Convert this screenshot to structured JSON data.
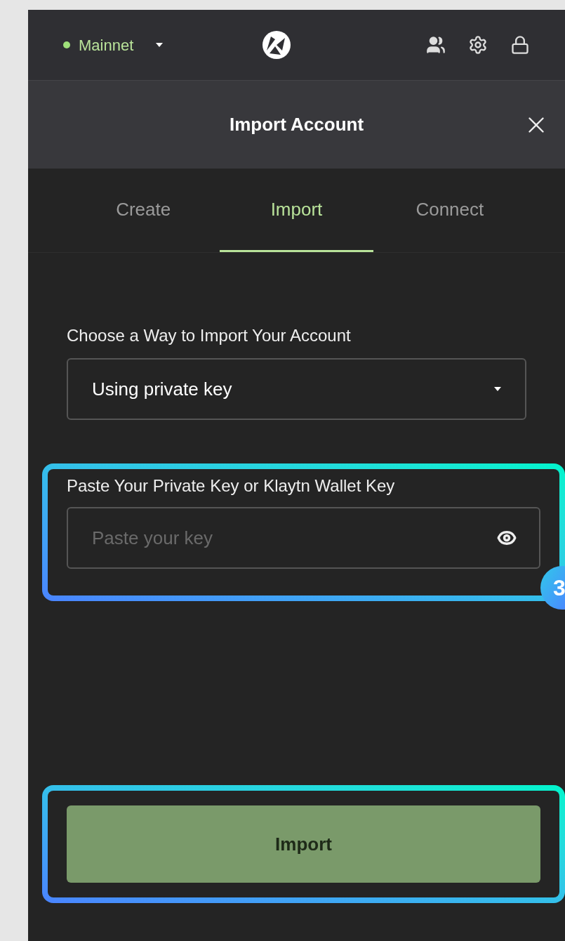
{
  "header": {
    "network": "Mainnet"
  },
  "dialog": {
    "title": "Import Account"
  },
  "tabs": [
    {
      "label": "Create",
      "selected": false
    },
    {
      "label": "Import",
      "selected": true
    },
    {
      "label": "Connect",
      "selected": false
    }
  ],
  "import_method": {
    "label": "Choose a Way to Import Your Account",
    "value": "Using private key"
  },
  "key_field": {
    "label": "Paste Your Private Key or Klaytn Wallet Key",
    "placeholder": "Paste your key"
  },
  "step_badge": "3",
  "submit_button": "Import"
}
